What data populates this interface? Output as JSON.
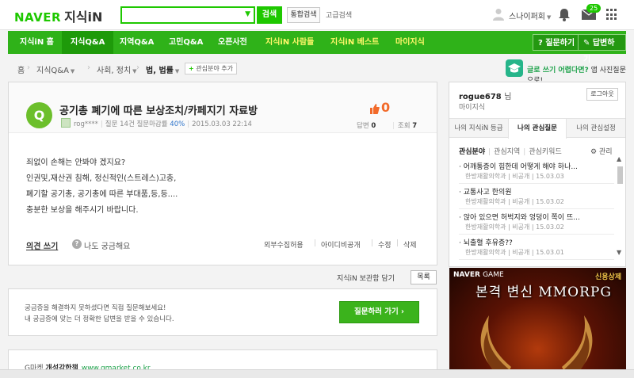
{
  "header": {
    "logo_brand": "NAVER",
    "logo_service": "지식iN",
    "search_placeholder": "",
    "search_button": "검색",
    "unified_search": "통합검색",
    "advanced_search": "고급검색",
    "user_name": "스나이퍼회",
    "mail_badge": "25"
  },
  "gnb": {
    "items": [
      "지식iN 홈",
      "지식Q&A",
      "지역Q&A",
      "고민Q&A",
      "오픈사전",
      "지식iN 사람들",
      "지식iN 베스트",
      "마이지식"
    ],
    "ask_button": "? 질문하기",
    "answer_button": "✎ 답변하기"
  },
  "breadcrumb": {
    "home": "홈",
    "qna": "지식Q&A",
    "category": "사회, 정치",
    "subcategory": "법, 법률",
    "interest_add": "관심분야 추가",
    "help_green": "글로 쓰기 어렵다면?",
    "help_rest": "앱 사진질문으로!"
  },
  "question": {
    "badge": "Q",
    "title": "공기총 폐기에 따른 보상조치/카페지기 자료방",
    "author": "rog****",
    "meta_questions": "질문 14건",
    "meta_rate_label": "질문마감률",
    "meta_rate_value": "40%",
    "date": "2015.03.03 22:14",
    "likes": "0",
    "answers_label": "답변",
    "answers_value": "0",
    "views_label": "조회",
    "views_value": "7",
    "body": [
      "죄없이 손해는 안봐야 겠지요?",
      "인권및,재산권 침해, 정신적인(스트레스)고충,",
      "폐기할 공기총, 공기총에 따른 부대품,등,등....",
      "충분한 보상을 해주시기 바랍니다."
    ],
    "opinion": "의견 쓰기",
    "curious": "나도 궁금해요",
    "curious_icon": "?",
    "foot_links": [
      "외부수집허용",
      "아이디비공개",
      "수정",
      "삭제"
    ]
  },
  "below": {
    "save_text": "지식iN 보관함 담기",
    "list_button": "목록"
  },
  "askbox": {
    "line1": "궁금증을 해결하지 못하셨다면 직접 질문해보세요!",
    "line2": "내 궁금증에 맞는 더 정확한 답변을 받을 수 있습니다.",
    "button": "질문하러 가기 ›"
  },
  "adbox": {
    "brand": "G마켓",
    "headline": "개성강한책",
    "url": "www.gmarket.co.kr"
  },
  "rpanel": {
    "user": "rogue678",
    "user_suffix": "님",
    "sub": "마이지식",
    "logout": "로그아웃",
    "tabs": [
      "나의 지식iN 등급",
      "나의 관심질문",
      "나의 관심설정"
    ],
    "subtabs": [
      "관심분야",
      "관심지역",
      "관심키워드"
    ],
    "manage": "⚙ 관리",
    "items": [
      {
        "title": "· 어깨통증이 힘한데 어떻게 해야 하나...",
        "meta": "한방재활의학과 | 비공개 | 15.03.03"
      },
      {
        "title": "· 교통사고 한의원",
        "meta": "한방재활의학과 | 비공개 | 15.03.02"
      },
      {
        "title": "· 앉아 있으면 허벅지와 엉덩이 쪽이 뜨...",
        "meta": "한방재활의학과 | 비공개 | 15.03.02"
      },
      {
        "title": "· 뇌출혈 후유증??",
        "meta": "한방재활의학과 | 비공개 | 15.03.01"
      }
    ]
  },
  "game_ad": {
    "brand": "NAVER",
    "brand_suffix": "GAME",
    "title": "본격 변신 MMORPG",
    "logo": "신용상제"
  },
  "colors": {
    "naver_green": "#1ec800",
    "nav_green": "#2fb219",
    "like_orange": "#f26a2a",
    "link_blue": "#2b72c9"
  }
}
